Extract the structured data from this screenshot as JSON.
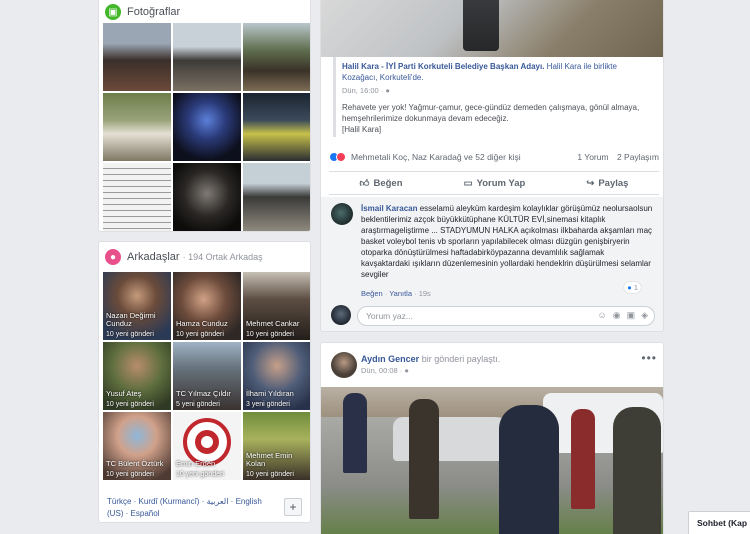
{
  "photos": {
    "title": "Fotoğraflar",
    "icon": "photo-icon",
    "items": [
      "group-photo",
      "audience-photo",
      "outdoor-group-photo",
      "garden-photo",
      "stage-photo",
      "ceremony-photo",
      "document-photo",
      "portrait-photo",
      "street-photo"
    ]
  },
  "friends": {
    "title": "Arkadaşlar",
    "subtitle": "· 194 Ortak Arkadaş",
    "icon": "friends-icon",
    "items": [
      {
        "name": "Nazan Değirmi Cunduz",
        "sub": "10 yeni gönderi"
      },
      {
        "name": "Hamza Cunduz",
        "sub": "10 yeni gönderi"
      },
      {
        "name": "Mehmet Cankar",
        "sub": "10 yeni gönderi"
      },
      {
        "name": "Yusuf Ateş",
        "sub": "10 yeni gönderi"
      },
      {
        "name": "TC Yılmaz Çıldır",
        "sub": "5 yeni gönderi"
      },
      {
        "name": "İlhami Yıldıran",
        "sub": "3 yeni gönderi"
      },
      {
        "name": "TC Bülent Öztürk",
        "sub": "10 yeni gönderi"
      },
      {
        "name": "Emin Erden",
        "sub": "10 yeni gönderi"
      },
      {
        "name": "Mehmet Emin Kolan",
        "sub": "10 yeni gönderi"
      }
    ],
    "languages": "Türkçe · Kurdî (Kurmancî) · العربية · English (US) · Español",
    "add_label": "+"
  },
  "post1": {
    "share_author": "Halil Kara",
    "share_headline": " - İYİ Parti Korkuteli Belediye Başkan Adayı. ",
    "share_with": "Halil Kara ile birlikte Kozağacı, Korkuteli'de.",
    "share_time": "Dün, 16:00 · ",
    "share_body": "Rehavete yer yok! Yağmur-çamur, gece-gündüz demeden çalışmaya, gönül almaya, hemşehrilerimize dokunmaya devam edeceğiz.",
    "share_sign": "[Halil Kara]",
    "reactions_text": "Mehmetali Koç, Naz Karadağ ve 52 diğer kişi",
    "comments_count": "1 Yorum",
    "shares_count": "2 Paylaşım",
    "like_label": "Beğen",
    "comment_label": "Yorum Yap",
    "share_label": "Paylaş",
    "comment": {
      "author": "İsmail Karacan",
      "text": " esselamü aleyküm kardeşim kolaylıklar görüşümüz neolursaolsun beklentilerimiz azçok büyükkütüphane KÜLTÜR EVİ,sinemasi kitaplık araştırmageliştirme ... STADYUMUN HALKA açıkolması ilkbaharda akşamları maç basket voleybol tenis vb sporların yapılabilecek olması düzgün genişbiryerin otoparka dönüştürülmesi haftadabirköypazanna devamlılık sağlamak kavşaktardaki ışıkların düzenlemesinin yollardaki hendeklrin düşürülmesi selamlar sevgiler",
      "like": "Beğen",
      "reply": "Yanıtla",
      "time": "19s",
      "likes": "1"
    },
    "write_placeholder": "Yorum yaz..."
  },
  "post2": {
    "author": "Aydın Gencer",
    "action": " bir gönderi paylaştı.",
    "time": "Dün, 00:08 · ",
    "more": "•••"
  },
  "chat": {
    "label": "Sohbet (Kap"
  },
  "colors": {
    "link": "#385898",
    "photos_icon": "#42b72a",
    "friends_icon": "#e8508c",
    "like_blue": "#1877f2"
  }
}
